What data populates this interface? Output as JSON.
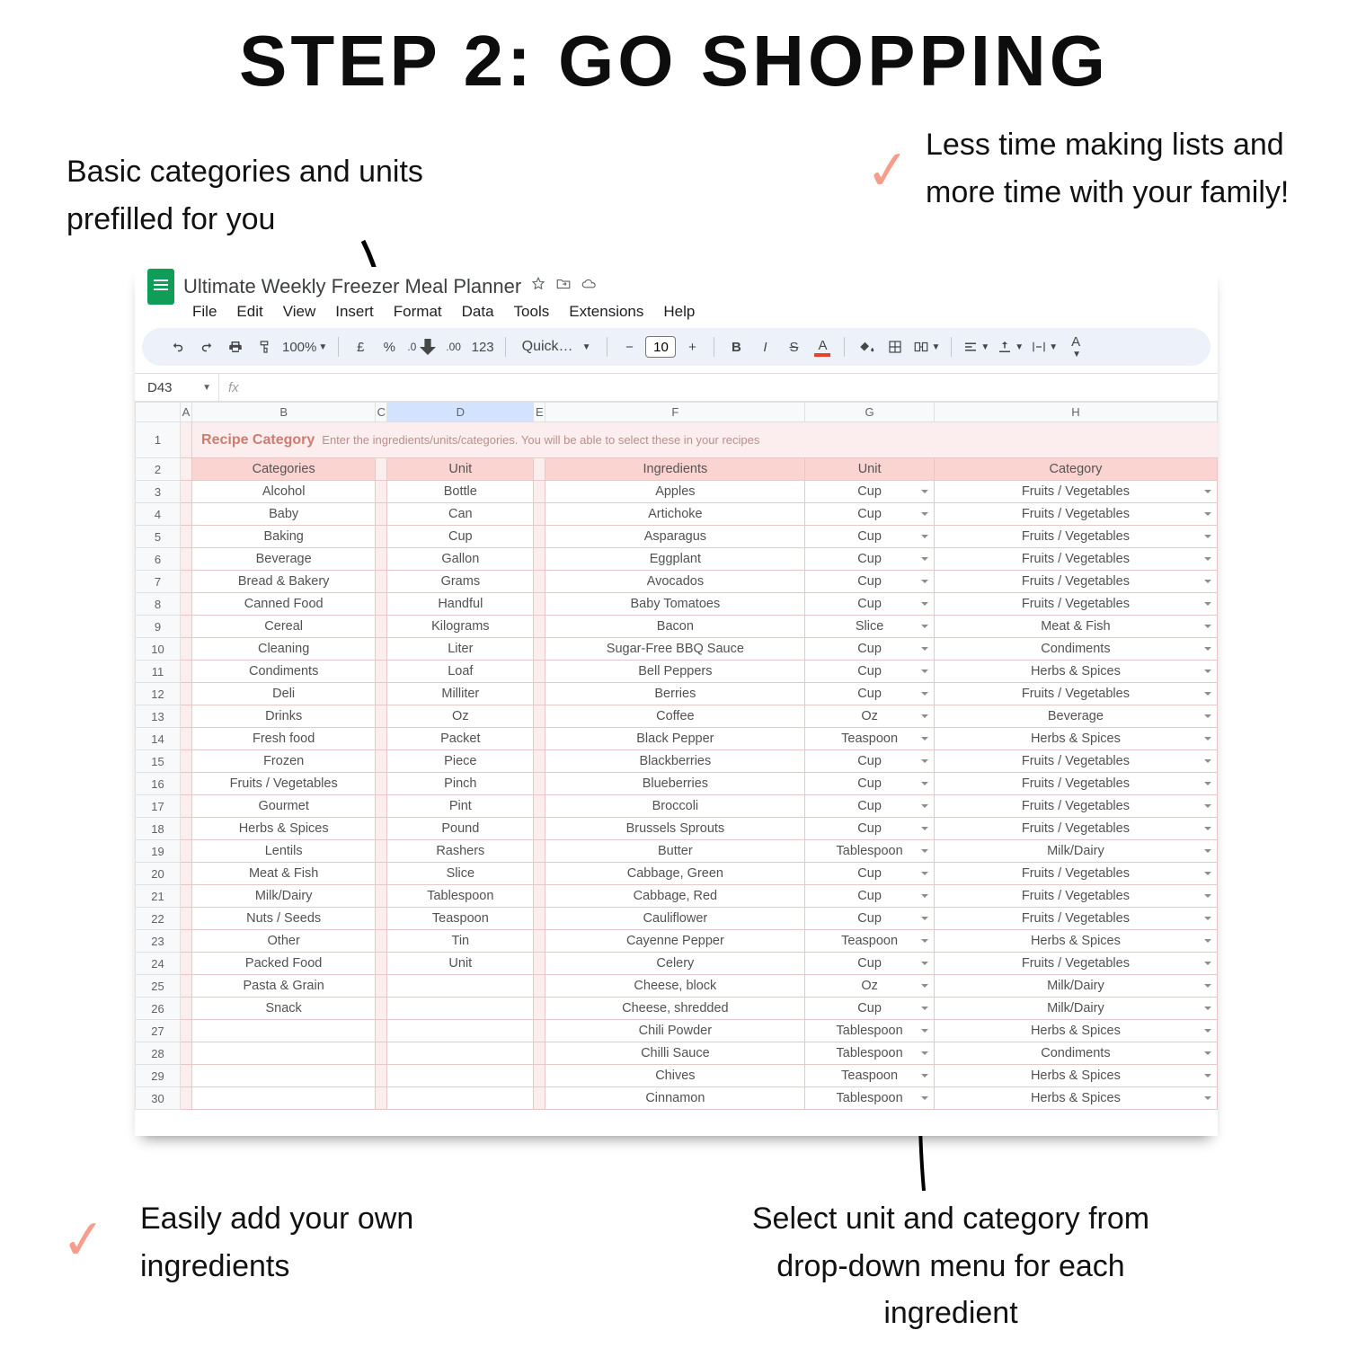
{
  "promo": {
    "heading": "STEP 2: GO SHOPPING",
    "anno_tl": "Basic categories and units prefilled for you",
    "anno_tr": "Less time making lists and more time with your family!",
    "anno_bl": "Easily add your own ingredients",
    "anno_br": "Select unit and category from drop-down menu for each ingredient"
  },
  "app": {
    "docTitle": "Ultimate Weekly Freezer Meal Planner",
    "menus": [
      "File",
      "Edit",
      "View",
      "Insert",
      "Format",
      "Data",
      "Tools",
      "Extensions",
      "Help"
    ],
    "zoom": "100%",
    "currency": "£",
    "percent": "%",
    "decDec": ".0",
    "incDec": ".00",
    "numFmt": "123",
    "font": "Quick…",
    "fontSize": "10",
    "nameBox": "D43"
  },
  "columns": [
    "A",
    "B",
    "C",
    "D",
    "E",
    "F",
    "G",
    "H"
  ],
  "sheet": {
    "titleLabel": "Recipe Category",
    "titleHint": "Enter the ingredients/units/categories. You will be able to select these in your recipes",
    "headers": {
      "categories": "Categories",
      "unit": "Unit",
      "ingredients": "Ingredients",
      "unit2": "Unit",
      "category": "Category"
    },
    "rows": [
      {
        "n": 3,
        "cat": "Alcohol",
        "u": "Bottle",
        "ing": "Apples",
        "iu": "Cup",
        "ic": "Fruits / Vegetables"
      },
      {
        "n": 4,
        "cat": "Baby",
        "u": "Can",
        "ing": "Artichoke",
        "iu": "Cup",
        "ic": "Fruits / Vegetables"
      },
      {
        "n": 5,
        "cat": "Baking",
        "u": "Cup",
        "ing": "Asparagus",
        "iu": "Cup",
        "ic": "Fruits / Vegetables"
      },
      {
        "n": 6,
        "cat": "Beverage",
        "u": "Gallon",
        "ing": "Eggplant",
        "iu": "Cup",
        "ic": "Fruits / Vegetables"
      },
      {
        "n": 7,
        "cat": "Bread & Bakery",
        "u": "Grams",
        "ing": "Avocados",
        "iu": "Cup",
        "ic": "Fruits / Vegetables"
      },
      {
        "n": 8,
        "cat": "Canned Food",
        "u": "Handful",
        "ing": "Baby Tomatoes",
        "iu": "Cup",
        "ic": "Fruits / Vegetables"
      },
      {
        "n": 9,
        "cat": "Cereal",
        "u": "Kilograms",
        "ing": "Bacon",
        "iu": "Slice",
        "ic": "Meat & Fish"
      },
      {
        "n": 10,
        "cat": "Cleaning",
        "u": "Liter",
        "ing": "Sugar-Free BBQ Sauce",
        "iu": "Cup",
        "ic": "Condiments"
      },
      {
        "n": 11,
        "cat": "Condiments",
        "u": "Loaf",
        "ing": "Bell Peppers",
        "iu": "Cup",
        "ic": "Herbs & Spices"
      },
      {
        "n": 12,
        "cat": "Deli",
        "u": "Milliter",
        "ing": "Berries",
        "iu": "Cup",
        "ic": "Fruits / Vegetables"
      },
      {
        "n": 13,
        "cat": "Drinks",
        "u": "Oz",
        "ing": "Coffee",
        "iu": "Oz",
        "ic": "Beverage"
      },
      {
        "n": 14,
        "cat": "Fresh food",
        "u": "Packet",
        "ing": "Black Pepper",
        "iu": "Teaspoon",
        "ic": "Herbs & Spices"
      },
      {
        "n": 15,
        "cat": "Frozen",
        "u": "Piece",
        "ing": "Blackberries",
        "iu": "Cup",
        "ic": "Fruits / Vegetables"
      },
      {
        "n": 16,
        "cat": "Fruits / Vegetables",
        "u": "Pinch",
        "ing": "Blueberries",
        "iu": "Cup",
        "ic": "Fruits / Vegetables"
      },
      {
        "n": 17,
        "cat": "Gourmet",
        "u": "Pint",
        "ing": "Broccoli",
        "iu": "Cup",
        "ic": "Fruits / Vegetables"
      },
      {
        "n": 18,
        "cat": "Herbs & Spices",
        "u": "Pound",
        "ing": "Brussels Sprouts",
        "iu": "Cup",
        "ic": "Fruits / Vegetables"
      },
      {
        "n": 19,
        "cat": "Lentils",
        "u": "Rashers",
        "ing": "Butter",
        "iu": "Tablespoon",
        "ic": "Milk/Dairy"
      },
      {
        "n": 20,
        "cat": "Meat & Fish",
        "u": "Slice",
        "ing": "Cabbage, Green",
        "iu": "Cup",
        "ic": "Fruits / Vegetables"
      },
      {
        "n": 21,
        "cat": "Milk/Dairy",
        "u": "Tablespoon",
        "ing": "Cabbage, Red",
        "iu": "Cup",
        "ic": "Fruits / Vegetables"
      },
      {
        "n": 22,
        "cat": "Nuts / Seeds",
        "u": "Teaspoon",
        "ing": "Cauliflower",
        "iu": "Cup",
        "ic": "Fruits / Vegetables"
      },
      {
        "n": 23,
        "cat": "Other",
        "u": "Tin",
        "ing": "Cayenne Pepper",
        "iu": "Teaspoon",
        "ic": "Herbs & Spices"
      },
      {
        "n": 24,
        "cat": "Packed Food",
        "u": "Unit",
        "ing": "Celery",
        "iu": "Cup",
        "ic": "Fruits / Vegetables"
      },
      {
        "n": 25,
        "cat": "Pasta & Grain",
        "u": "",
        "ing": "Cheese, block",
        "iu": "Oz",
        "ic": "Milk/Dairy"
      },
      {
        "n": 26,
        "cat": "Snack",
        "u": "",
        "ing": "Cheese, shredded",
        "iu": "Cup",
        "ic": "Milk/Dairy"
      },
      {
        "n": 27,
        "cat": "",
        "u": "",
        "ing": "Chili Powder",
        "iu": "Tablespoon",
        "ic": "Herbs & Spices"
      },
      {
        "n": 28,
        "cat": "",
        "u": "",
        "ing": "Chilli Sauce",
        "iu": "Tablespoon",
        "ic": "Condiments"
      },
      {
        "n": 29,
        "cat": "",
        "u": "",
        "ing": "Chives",
        "iu": "Teaspoon",
        "ic": "Herbs & Spices"
      },
      {
        "n": 30,
        "cat": "",
        "u": "",
        "ing": "Cinnamon",
        "iu": "Tablespoon",
        "ic": "Herbs & Spices"
      }
    ]
  }
}
